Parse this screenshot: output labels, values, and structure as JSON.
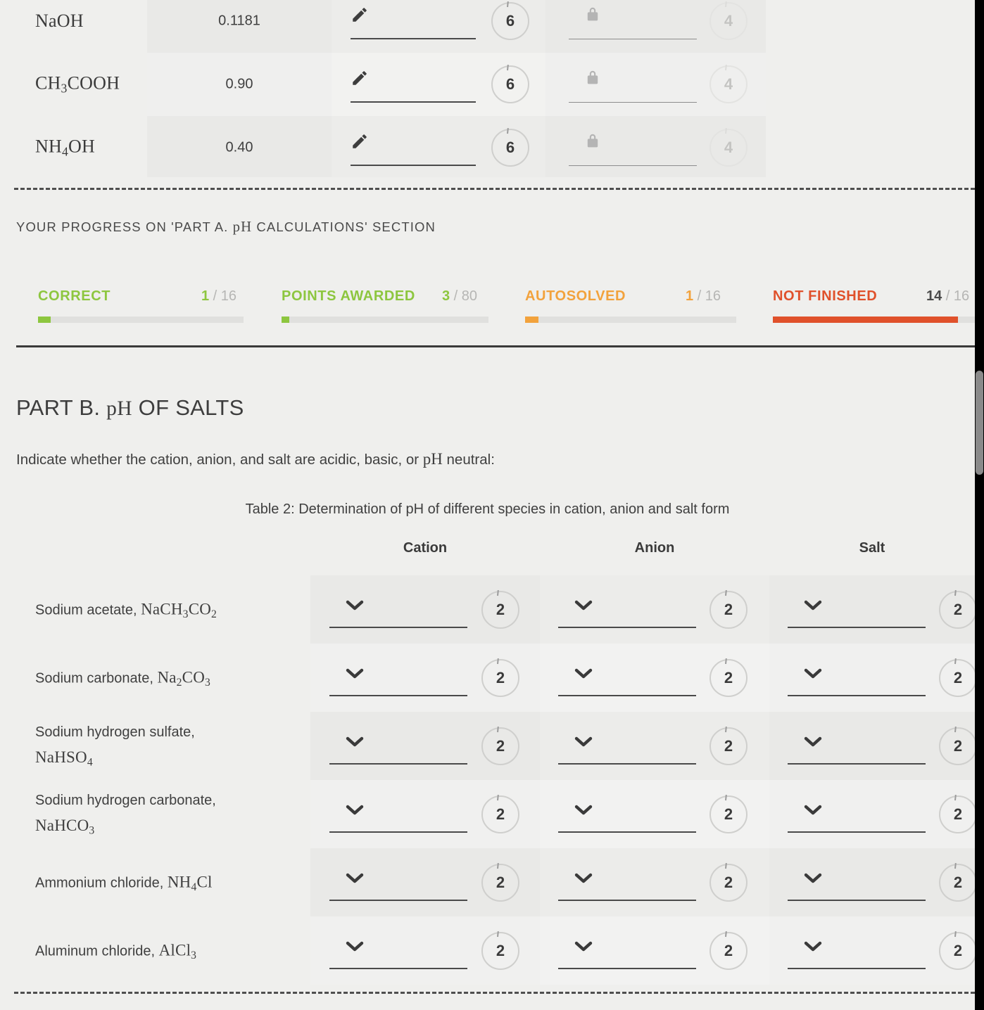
{
  "table1": {
    "rows": [
      {
        "name_html": "NaOH",
        "value": "0.1181",
        "field1": {
          "icon": "pencil-icon",
          "state": "editable"
        },
        "badge1": "6",
        "field2": {
          "icon": "lock-icon",
          "state": "locked"
        },
        "badge2": "4"
      },
      {
        "name_html": "CH<sub>3</sub>COOH",
        "value": "0.90",
        "field1": {
          "icon": "pencil-icon",
          "state": "editable"
        },
        "badge1": "6",
        "field2": {
          "icon": "lock-icon",
          "state": "locked"
        },
        "badge2": "4"
      },
      {
        "name_html": "NH<sub>4</sub>OH",
        "value": "0.40",
        "field1": {
          "icon": "pencil-icon",
          "state": "editable"
        },
        "badge1": "6",
        "field2": {
          "icon": "lock-icon",
          "state": "locked"
        },
        "badge2": "4"
      }
    ]
  },
  "progress": {
    "title_prefix": "YOUR PROGRESS ON 'PART A. ",
    "title_ph": "pH",
    "title_suffix": " CALCULATIONS' SECTION",
    "title_full": "YOUR PROGRESS ON 'PART A. pH CALCULATIONS' SECTION",
    "stats": [
      {
        "label": "CORRECT",
        "current": "1",
        "separator": "/",
        "total": "16",
        "color": "#8dc63f",
        "percent": 6.25
      },
      {
        "label": "POINTS AWARDED",
        "current": "3",
        "separator": "/",
        "total": "80",
        "color": "#8dc63f",
        "percent": 3.75
      },
      {
        "label": "AUTOSOLVED",
        "current": "1",
        "separator": "/",
        "total": "16",
        "color": "#f2a23c",
        "percent": 6.25
      },
      {
        "label": "NOT FINISHED",
        "current": "14",
        "separator": "/",
        "total": "16",
        "color": "#e0512b",
        "percent": 87.5
      }
    ]
  },
  "part_b": {
    "heading_prefix": "PART B. ",
    "heading_ph": "pH",
    "heading_suffix": " OF SALTS",
    "heading_full": "PART B. pH OF SALTS",
    "instruction_prefix": "Indicate whether the cation, anion, and salt are acidic, basic, or ",
    "instruction_ph": "pH",
    "instruction_suffix": " neutral:",
    "instruction_full": "Indicate whether the cation, anion, and salt are acidic, basic, or pH neutral:",
    "table_caption": "Table 2: Determination of pH of different species in cation, anion and salt form",
    "columns": [
      "Cation",
      "Anion",
      "Salt"
    ],
    "rows": [
      {
        "label": "Sodium acetate,",
        "formula_html": "NaCH<sub>3</sub>CO<sub>2</sub>",
        "inline": true,
        "cells": [
          {
            "icon": "chevron-down-icon",
            "badge": "2"
          },
          {
            "icon": "chevron-down-icon",
            "badge": "2"
          },
          {
            "icon": "chevron-down-icon",
            "badge": "2"
          }
        ]
      },
      {
        "label": "Sodium carbonate,",
        "formula_html": "Na<sub>2</sub>CO<sub>3</sub>",
        "inline": true,
        "cells": [
          {
            "icon": "chevron-down-icon",
            "badge": "2"
          },
          {
            "icon": "chevron-down-icon",
            "badge": "2"
          },
          {
            "icon": "chevron-down-icon",
            "badge": "2"
          }
        ]
      },
      {
        "label": "Sodium hydrogen sulfate,",
        "formula_html": "NaHSO<sub>4</sub>",
        "inline": false,
        "cells": [
          {
            "icon": "chevron-down-icon",
            "badge": "2"
          },
          {
            "icon": "chevron-down-icon",
            "badge": "2"
          },
          {
            "icon": "chevron-down-icon",
            "badge": "2"
          }
        ]
      },
      {
        "label": "Sodium hydrogen carbonate,",
        "formula_html": "NaHCO<sub>3</sub>",
        "inline": false,
        "cells": [
          {
            "icon": "chevron-down-icon",
            "badge": "2"
          },
          {
            "icon": "chevron-down-icon",
            "badge": "2"
          },
          {
            "icon": "chevron-down-icon",
            "badge": "2"
          }
        ]
      },
      {
        "label": "Ammonium chloride,",
        "formula_html": "NH<sub>4</sub>Cl",
        "inline": true,
        "cells": [
          {
            "icon": "chevron-down-icon",
            "badge": "2"
          },
          {
            "icon": "chevron-down-icon",
            "badge": "2"
          },
          {
            "icon": "chevron-down-icon",
            "badge": "2"
          }
        ]
      },
      {
        "label": "Aluminum chloride,",
        "formula_html": "AlCl<sub>3</sub>",
        "inline": true,
        "cells": [
          {
            "icon": "chevron-down-icon",
            "badge": "2"
          },
          {
            "icon": "chevron-down-icon",
            "badge": "2"
          },
          {
            "icon": "chevron-down-icon",
            "badge": "2"
          }
        ]
      }
    ]
  },
  "colors": {
    "page_bg": "#efefed",
    "green": "#8dc63f",
    "orange": "#f2a23c",
    "red": "#e0512b",
    "text": "#3a3a3a",
    "muted": "#b6b6b4"
  },
  "scrollbar": {
    "present": true
  }
}
